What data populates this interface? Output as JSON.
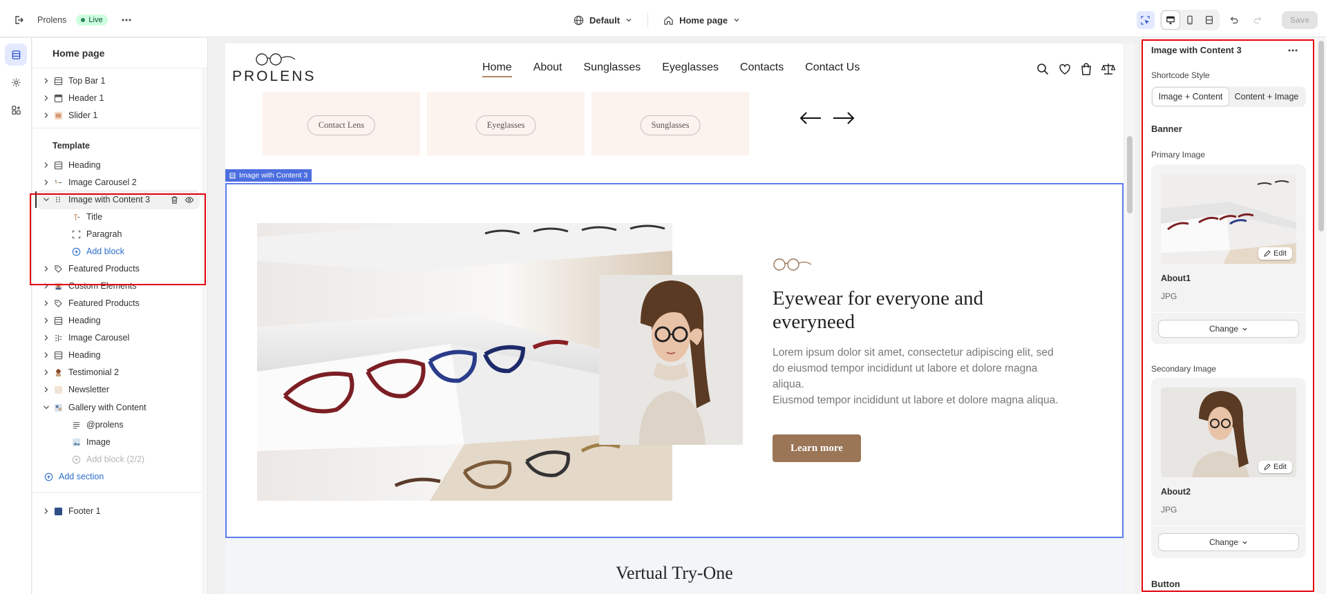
{
  "topbar": {
    "store_name": "Prolens",
    "status_badge": "Live",
    "theme_selector": "Default",
    "page_selector": "Home page",
    "save_label": "Save"
  },
  "tree": {
    "title": "Home page",
    "header_sections": [
      {
        "label": "Top Bar 1",
        "icon": "section-icon"
      },
      {
        "label": "Header 1",
        "icon": "header-icon"
      },
      {
        "label": "Slider 1",
        "icon": "slider-thumb-icon"
      }
    ],
    "template_label": "Template",
    "template_sections_a": [
      {
        "label": "Heading",
        "icon": "section-icon"
      },
      {
        "label": "Image Carousel 2",
        "icon": "carousel-icon"
      }
    ],
    "selected_section": {
      "label": "Image with Content 3",
      "blocks": [
        {
          "label": "Title",
          "icon": "title-icon"
        },
        {
          "label": "Paragrah",
          "icon": "paragraph-icon"
        }
      ],
      "add_block": "Add block"
    },
    "template_sections_b": [
      {
        "label": "Featured Products",
        "icon": "tag-icon"
      },
      {
        "label": "Custom Elements",
        "icon": "custom-icon"
      },
      {
        "label": "Featured Products",
        "icon": "tag-icon"
      },
      {
        "label": "Heading",
        "icon": "section-icon"
      },
      {
        "label": "Image Carousel",
        "icon": "carousel-icon"
      },
      {
        "label": "Heading",
        "icon": "section-icon"
      },
      {
        "label": "Testimonial 2",
        "icon": "testimonial-icon"
      },
      {
        "label": "Newsletter",
        "icon": "newsletter-icon"
      }
    ],
    "gallery_section": {
      "label": "Gallery with Content",
      "blocks": [
        {
          "label": "@prolens",
          "icon": "text-lines-icon"
        },
        {
          "label": "Image",
          "icon": "image-icon"
        }
      ],
      "add_block": "Add block (2/2)"
    },
    "add_section": "Add section",
    "footer_sections": [
      {
        "label": "Footer 1",
        "icon": "footer-icon"
      }
    ]
  },
  "preview": {
    "logo_text": "PROLENS",
    "nav": [
      "Home",
      "About",
      "Sunglasses",
      "Eyeglasses",
      "Contacts",
      "Contact Us"
    ],
    "categories": [
      "Contact Lens",
      "Eyeglasses",
      "Sunglasses"
    ],
    "section_tag": "Image with Content 3",
    "hero_title": "Eyewear for everyone and everyneed",
    "hero_paragraph_1": "Lorem ipsum dolor sit amet, consectetur adipiscing elit, sed do eiusmod tempor incididunt ut labore et dolore magna aliqua.",
    "hero_paragraph_2": "Eiusmod tempor incididunt ut labore et dolore magna aliqua.",
    "cta_label": "Learn more",
    "next_section_title": "Vertual Try-One"
  },
  "panel": {
    "title": "Image with Content 3",
    "shortcode_style_label": "Shortcode Style",
    "shortcode_options": [
      "Image + Content",
      "Content + Image"
    ],
    "shortcode_selected": "Image + Content",
    "banner_heading": "Banner",
    "primary_image": {
      "label": "Primary Image",
      "name": "About1",
      "type": "JPG",
      "edit": "Edit",
      "change": "Change"
    },
    "secondary_image": {
      "label": "Secondary Image",
      "name": "About2",
      "type": "JPG",
      "edit": "Edit",
      "change": "Change"
    },
    "button_heading": "Button"
  },
  "colors": {
    "accent": "#4c6ee0",
    "highlight_box": "#e3000f",
    "cta_brown": "#9a7556",
    "category_card_bg": "#fdf3ee",
    "live_badge_bg": "#cdfee1"
  }
}
